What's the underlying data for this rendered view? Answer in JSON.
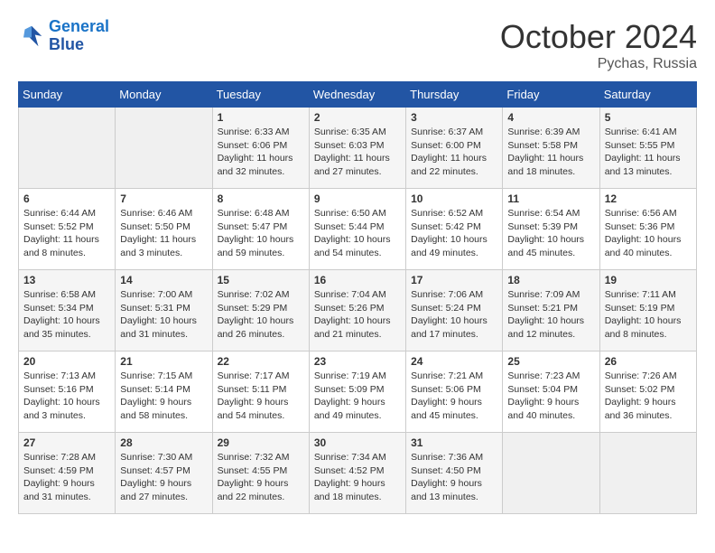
{
  "header": {
    "logo_line1": "General",
    "logo_line2": "Blue",
    "month": "October 2024",
    "location": "Pychas, Russia"
  },
  "weekdays": [
    "Sunday",
    "Monday",
    "Tuesday",
    "Wednesday",
    "Thursday",
    "Friday",
    "Saturday"
  ],
  "weeks": [
    [
      {
        "day": "",
        "content": ""
      },
      {
        "day": "",
        "content": ""
      },
      {
        "day": "1",
        "content": "Sunrise: 6:33 AM\nSunset: 6:06 PM\nDaylight: 11 hours and 32 minutes."
      },
      {
        "day": "2",
        "content": "Sunrise: 6:35 AM\nSunset: 6:03 PM\nDaylight: 11 hours and 27 minutes."
      },
      {
        "day": "3",
        "content": "Sunrise: 6:37 AM\nSunset: 6:00 PM\nDaylight: 11 hours and 22 minutes."
      },
      {
        "day": "4",
        "content": "Sunrise: 6:39 AM\nSunset: 5:58 PM\nDaylight: 11 hours and 18 minutes."
      },
      {
        "day": "5",
        "content": "Sunrise: 6:41 AM\nSunset: 5:55 PM\nDaylight: 11 hours and 13 minutes."
      }
    ],
    [
      {
        "day": "6",
        "content": "Sunrise: 6:44 AM\nSunset: 5:52 PM\nDaylight: 11 hours and 8 minutes."
      },
      {
        "day": "7",
        "content": "Sunrise: 6:46 AM\nSunset: 5:50 PM\nDaylight: 11 hours and 3 minutes."
      },
      {
        "day": "8",
        "content": "Sunrise: 6:48 AM\nSunset: 5:47 PM\nDaylight: 10 hours and 59 minutes."
      },
      {
        "day": "9",
        "content": "Sunrise: 6:50 AM\nSunset: 5:44 PM\nDaylight: 10 hours and 54 minutes."
      },
      {
        "day": "10",
        "content": "Sunrise: 6:52 AM\nSunset: 5:42 PM\nDaylight: 10 hours and 49 minutes."
      },
      {
        "day": "11",
        "content": "Sunrise: 6:54 AM\nSunset: 5:39 PM\nDaylight: 10 hours and 45 minutes."
      },
      {
        "day": "12",
        "content": "Sunrise: 6:56 AM\nSunset: 5:36 PM\nDaylight: 10 hours and 40 minutes."
      }
    ],
    [
      {
        "day": "13",
        "content": "Sunrise: 6:58 AM\nSunset: 5:34 PM\nDaylight: 10 hours and 35 minutes."
      },
      {
        "day": "14",
        "content": "Sunrise: 7:00 AM\nSunset: 5:31 PM\nDaylight: 10 hours and 31 minutes."
      },
      {
        "day": "15",
        "content": "Sunrise: 7:02 AM\nSunset: 5:29 PM\nDaylight: 10 hours and 26 minutes."
      },
      {
        "day": "16",
        "content": "Sunrise: 7:04 AM\nSunset: 5:26 PM\nDaylight: 10 hours and 21 minutes."
      },
      {
        "day": "17",
        "content": "Sunrise: 7:06 AM\nSunset: 5:24 PM\nDaylight: 10 hours and 17 minutes."
      },
      {
        "day": "18",
        "content": "Sunrise: 7:09 AM\nSunset: 5:21 PM\nDaylight: 10 hours and 12 minutes."
      },
      {
        "day": "19",
        "content": "Sunrise: 7:11 AM\nSunset: 5:19 PM\nDaylight: 10 hours and 8 minutes."
      }
    ],
    [
      {
        "day": "20",
        "content": "Sunrise: 7:13 AM\nSunset: 5:16 PM\nDaylight: 10 hours and 3 minutes."
      },
      {
        "day": "21",
        "content": "Sunrise: 7:15 AM\nSunset: 5:14 PM\nDaylight: 9 hours and 58 minutes."
      },
      {
        "day": "22",
        "content": "Sunrise: 7:17 AM\nSunset: 5:11 PM\nDaylight: 9 hours and 54 minutes."
      },
      {
        "day": "23",
        "content": "Sunrise: 7:19 AM\nSunset: 5:09 PM\nDaylight: 9 hours and 49 minutes."
      },
      {
        "day": "24",
        "content": "Sunrise: 7:21 AM\nSunset: 5:06 PM\nDaylight: 9 hours and 45 minutes."
      },
      {
        "day": "25",
        "content": "Sunrise: 7:23 AM\nSunset: 5:04 PM\nDaylight: 9 hours and 40 minutes."
      },
      {
        "day": "26",
        "content": "Sunrise: 7:26 AM\nSunset: 5:02 PM\nDaylight: 9 hours and 36 minutes."
      }
    ],
    [
      {
        "day": "27",
        "content": "Sunrise: 7:28 AM\nSunset: 4:59 PM\nDaylight: 9 hours and 31 minutes."
      },
      {
        "day": "28",
        "content": "Sunrise: 7:30 AM\nSunset: 4:57 PM\nDaylight: 9 hours and 27 minutes."
      },
      {
        "day": "29",
        "content": "Sunrise: 7:32 AM\nSunset: 4:55 PM\nDaylight: 9 hours and 22 minutes."
      },
      {
        "day": "30",
        "content": "Sunrise: 7:34 AM\nSunset: 4:52 PM\nDaylight: 9 hours and 18 minutes."
      },
      {
        "day": "31",
        "content": "Sunrise: 7:36 AM\nSunset: 4:50 PM\nDaylight: 9 hours and 13 minutes."
      },
      {
        "day": "",
        "content": ""
      },
      {
        "day": "",
        "content": ""
      }
    ]
  ]
}
